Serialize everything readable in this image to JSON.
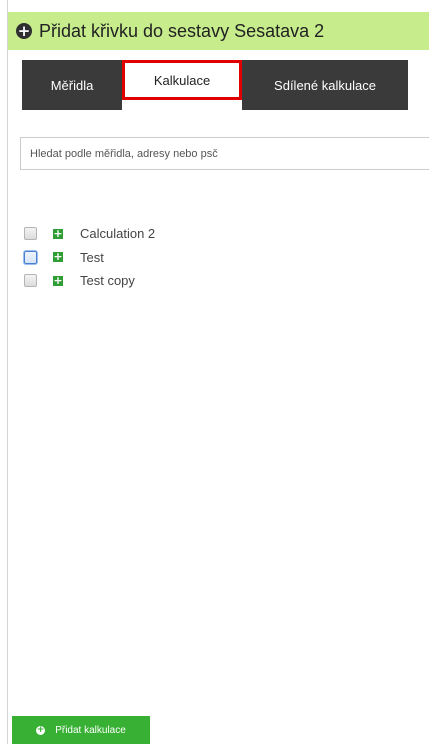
{
  "header": {
    "icon": "plus-circle-icon",
    "title": "Přidat křivku do sestavy Sesatava 2"
  },
  "tabs": [
    {
      "label": "Měřidla",
      "active": false
    },
    {
      "label": "Kalkulace",
      "active": true
    },
    {
      "label": "Sdílené kalkulace",
      "active": false
    }
  ],
  "search": {
    "placeholder": "Hledat podle měřidla, adresy nebo psč",
    "value": ""
  },
  "calculations": [
    {
      "label": "Calculation 2",
      "checked": false,
      "focused": false,
      "icon": "plus-square-icon"
    },
    {
      "label": "Test",
      "checked": false,
      "focused": true,
      "icon": "plus-square-icon"
    },
    {
      "label": "Test copy",
      "checked": false,
      "focused": false,
      "icon": "plus-square-icon"
    }
  ],
  "footer": {
    "add_button_label": "Přidat kalkulace",
    "add_button_icon": "plus-circle-icon"
  },
  "colors": {
    "header_bg": "#c6ec8c",
    "tab_bg": "#3a3a3a",
    "active_tab_border": "#e00000",
    "button_bg": "#37b034",
    "plus_icon": "#2e9e34"
  }
}
